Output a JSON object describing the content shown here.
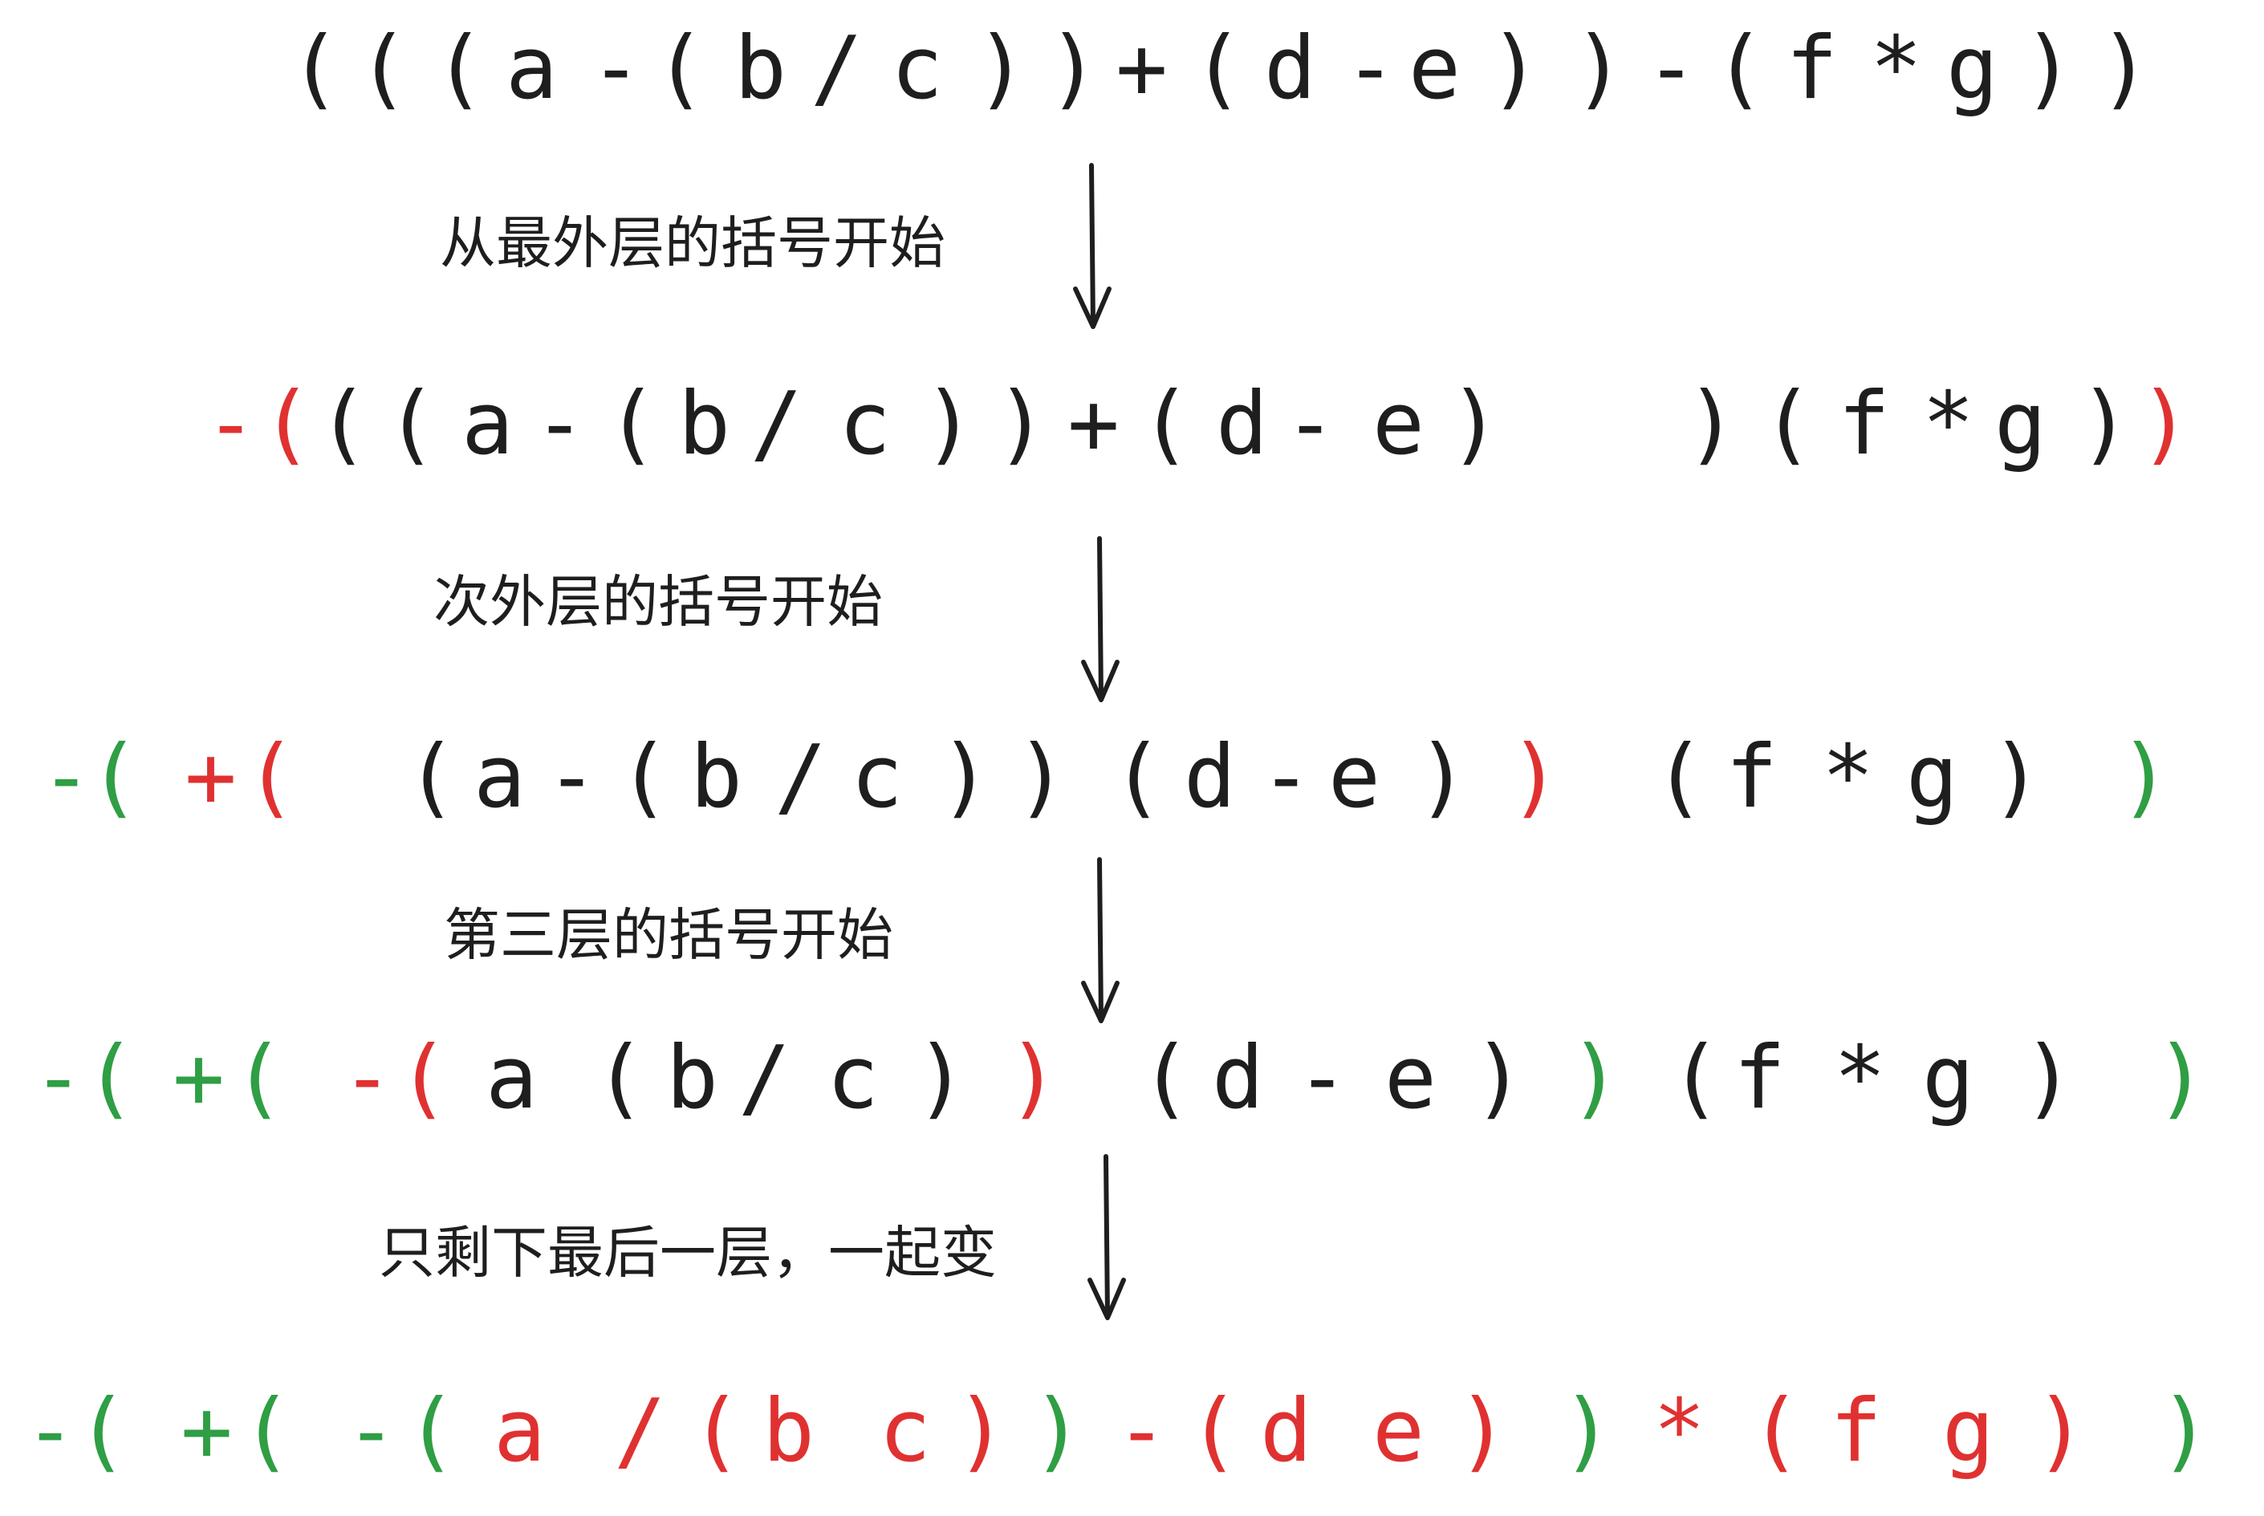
{
  "colors": {
    "black": "#1e1e1e",
    "red": "#e03131",
    "green": "#2f9e44"
  },
  "steps": [
    {
      "id": "original-expression",
      "tokens": [
        {
          "t": "(",
          "c": "black"
        },
        {
          "t": "(",
          "c": "black"
        },
        {
          "t": "(",
          "c": "black"
        },
        {
          "t": "a",
          "c": "black"
        },
        {
          "t": "-",
          "c": "black"
        },
        {
          "t": "(",
          "c": "black"
        },
        {
          "t": "b",
          "c": "black"
        },
        {
          "t": "/",
          "c": "black"
        },
        {
          "t": "c",
          "c": "black"
        },
        {
          "t": ")",
          "c": "black"
        },
        {
          "t": ")",
          "c": "black"
        },
        {
          "t": "+",
          "c": "black"
        },
        {
          "t": "(",
          "c": "black"
        },
        {
          "t": "d",
          "c": "black"
        },
        {
          "t": "-",
          "c": "black"
        },
        {
          "t": "e",
          "c": "black"
        },
        {
          "t": ")",
          "c": "black"
        },
        {
          "t": ")",
          "c": "black"
        },
        {
          "t": "-",
          "c": "black"
        },
        {
          "t": "(",
          "c": "black"
        },
        {
          "t": "f",
          "c": "black"
        },
        {
          "t": "*",
          "c": "black"
        },
        {
          "t": "g",
          "c": "black"
        },
        {
          "t": ")",
          "c": "black"
        },
        {
          "t": ")",
          "c": "black"
        }
      ]
    },
    {
      "id": "outermost-expression",
      "tokens": [
        {
          "t": "-",
          "c": "red"
        },
        {
          "t": "(",
          "c": "red"
        },
        {
          "t": "(",
          "c": "black"
        },
        {
          "t": "(",
          "c": "black"
        },
        {
          "t": "a",
          "c": "black"
        },
        {
          "t": "-",
          "c": "black"
        },
        {
          "t": "(",
          "c": "black"
        },
        {
          "t": "b",
          "c": "black"
        },
        {
          "t": "/",
          "c": "black"
        },
        {
          "t": "c",
          "c": "black"
        },
        {
          "t": ")",
          "c": "black"
        },
        {
          "t": ")",
          "c": "black"
        },
        {
          "t": "+",
          "c": "black"
        },
        {
          "t": "(",
          "c": "black"
        },
        {
          "t": "d",
          "c": "black"
        },
        {
          "t": "-",
          "c": "black"
        },
        {
          "t": "e",
          "c": "black"
        },
        {
          "t": ")",
          "c": "black"
        },
        {
          "t": ")",
          "c": "black"
        },
        {
          "t": "(",
          "c": "black"
        },
        {
          "t": "f",
          "c": "black"
        },
        {
          "t": "*",
          "c": "black"
        },
        {
          "t": "g",
          "c": "black"
        },
        {
          "t": ")",
          "c": "black"
        },
        {
          "t": ")",
          "c": "red"
        }
      ]
    },
    {
      "id": "second-level-expression",
      "tokens": [
        {
          "t": "-",
          "c": "green"
        },
        {
          "t": "(",
          "c": "green"
        },
        {
          "t": "+",
          "c": "red"
        },
        {
          "t": "(",
          "c": "red"
        },
        {
          "t": "(",
          "c": "black"
        },
        {
          "t": "a",
          "c": "black"
        },
        {
          "t": "-",
          "c": "black"
        },
        {
          "t": "(",
          "c": "black"
        },
        {
          "t": "b",
          "c": "black"
        },
        {
          "t": "/",
          "c": "black"
        },
        {
          "t": "c",
          "c": "black"
        },
        {
          "t": ")",
          "c": "black"
        },
        {
          "t": ")",
          "c": "black"
        },
        {
          "t": "(",
          "c": "black"
        },
        {
          "t": "d",
          "c": "black"
        },
        {
          "t": "-",
          "c": "black"
        },
        {
          "t": "e",
          "c": "black"
        },
        {
          "t": ")",
          "c": "black"
        },
        {
          "t": ")",
          "c": "red"
        },
        {
          "t": "(",
          "c": "black"
        },
        {
          "t": "f",
          "c": "black"
        },
        {
          "t": "*",
          "c": "black"
        },
        {
          "t": "g",
          "c": "black"
        },
        {
          "t": ")",
          "c": "black"
        },
        {
          "t": ")",
          "c": "green"
        }
      ]
    },
    {
      "id": "third-level-expression",
      "tokens": [
        {
          "t": "-",
          "c": "green"
        },
        {
          "t": "(",
          "c": "green"
        },
        {
          "t": "+",
          "c": "green"
        },
        {
          "t": "(",
          "c": "green"
        },
        {
          "t": "-",
          "c": "red"
        },
        {
          "t": "(",
          "c": "red"
        },
        {
          "t": "a",
          "c": "black"
        },
        {
          "t": "(",
          "c": "black"
        },
        {
          "t": "b",
          "c": "black"
        },
        {
          "t": "/",
          "c": "black"
        },
        {
          "t": "c",
          "c": "black"
        },
        {
          "t": ")",
          "c": "black"
        },
        {
          "t": ")",
          "c": "red"
        },
        {
          "t": "(",
          "c": "black"
        },
        {
          "t": "d",
          "c": "black"
        },
        {
          "t": "-",
          "c": "black"
        },
        {
          "t": "e",
          "c": "black"
        },
        {
          "t": ")",
          "c": "black"
        },
        {
          "t": ")",
          "c": "green"
        },
        {
          "t": "(",
          "c": "black"
        },
        {
          "t": "f",
          "c": "black"
        },
        {
          "t": "*",
          "c": "black"
        },
        {
          "t": "g",
          "c": "black"
        },
        {
          "t": ")",
          "c": "black"
        },
        {
          "t": ")",
          "c": "green"
        }
      ]
    },
    {
      "id": "final-expression",
      "tokens": [
        {
          "t": "-",
          "c": "green"
        },
        {
          "t": "(",
          "c": "green"
        },
        {
          "t": "+",
          "c": "green"
        },
        {
          "t": "(",
          "c": "green"
        },
        {
          "t": "-",
          "c": "green"
        },
        {
          "t": "(",
          "c": "green"
        },
        {
          "t": "a",
          "c": "red"
        },
        {
          "t": "/",
          "c": "red"
        },
        {
          "t": "(",
          "c": "red"
        },
        {
          "t": "b",
          "c": "red"
        },
        {
          "t": "c",
          "c": "red"
        },
        {
          "t": ")",
          "c": "red"
        },
        {
          "t": ")",
          "c": "green"
        },
        {
          "t": "-",
          "c": "red"
        },
        {
          "t": "(",
          "c": "red"
        },
        {
          "t": "d",
          "c": "red"
        },
        {
          "t": "e",
          "c": "red"
        },
        {
          "t": ")",
          "c": "red"
        },
        {
          "t": ")",
          "c": "green"
        },
        {
          "t": "*",
          "c": "red"
        },
        {
          "t": "(",
          "c": "red"
        },
        {
          "t": "f",
          "c": "red"
        },
        {
          "t": "g",
          "c": "red"
        },
        {
          "t": ")",
          "c": "red"
        },
        {
          "t": ")",
          "c": "green"
        }
      ]
    }
  ],
  "captions": [
    "从最外层的括号开始",
    "次外层的括号开始",
    "第三层的括号开始",
    "只剩下最后一层，一起变"
  ],
  "arrow_icon": "arrow-down-icon"
}
